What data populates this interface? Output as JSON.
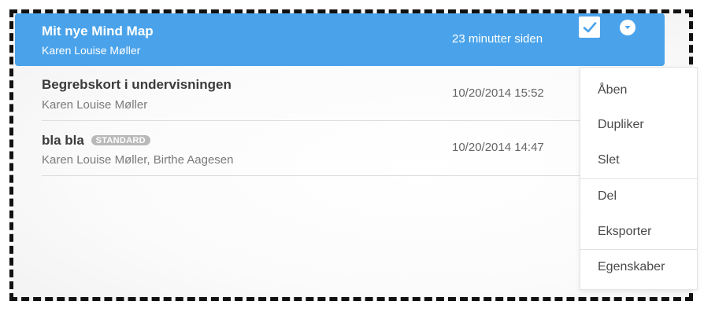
{
  "rows": [
    {
      "title": "Mit nye Mind Map",
      "authors": "Karen Louise Møller",
      "time": "23 minutter siden",
      "selected": true
    },
    {
      "title": "Begrebskort i undervisningen",
      "authors": "Karen Louise Møller",
      "time": "10/20/2014 15:52"
    },
    {
      "title": "bla bla",
      "badge": "STANDARD",
      "authors": "Karen Louise Møller, Birthe Aagesen",
      "time": "10/20/2014 14:47"
    }
  ],
  "menu": {
    "items": [
      "Åben",
      "Dupliker",
      "Slet",
      "Del",
      "Eksporter",
      "Egenskaber"
    ]
  },
  "colors": {
    "selected_row": "#4aa3ea",
    "badge": "#b9b9b9"
  },
  "icons": {
    "checkbox": "checkmark-icon",
    "dropdown": "chevron-down-icon"
  }
}
